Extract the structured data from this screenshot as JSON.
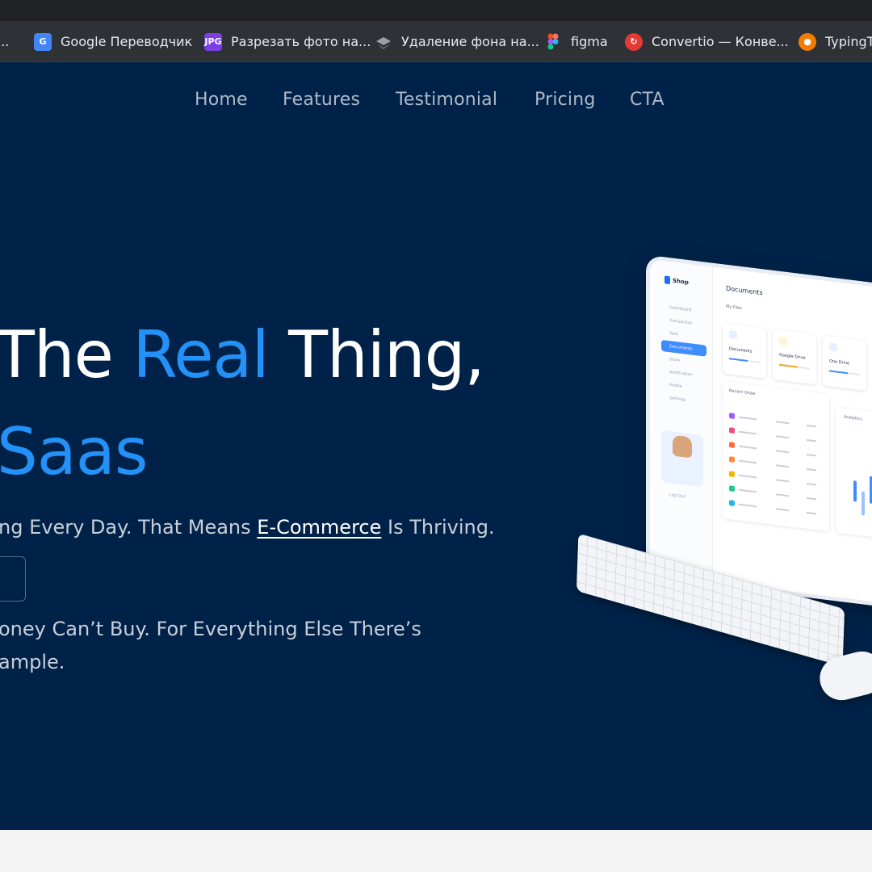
{
  "bookmarks": [
    {
      "label": "...",
      "icon": "bookmark-icon"
    },
    {
      "label": "Google Переводчик",
      "icon": "google-translate-icon",
      "color": "#4285f4"
    },
    {
      "label": "Разрезать фото на...",
      "icon": "jpg-icon",
      "color": "#7b3fe4"
    },
    {
      "label": "Удаление фона на...",
      "icon": "layers-icon",
      "color": "#9aa0a6"
    },
    {
      "label": "figma",
      "icon": "figma-icon",
      "color": "#f24e1e"
    },
    {
      "label": "Convertio — Конве...",
      "icon": "convertio-icon",
      "color": "#e53935"
    },
    {
      "label": "TypingT",
      "icon": "typing-icon",
      "color": "#f57c00"
    }
  ],
  "nav": [
    "Home",
    "Features",
    "Testimonial",
    "Pricing",
    "CTA"
  ],
  "hero": {
    "title_line1_a": "The ",
    "title_line1_accent": "Real",
    "title_line1_b": " Thing,",
    "title_line2_accent": "Saas",
    "subtitle_a": "ng Every Day. That Means ",
    "subtitle_link": "E-Commerce",
    "subtitle_b": " Is Thriving.",
    "body_line1": "oney Can’t Buy. For Everything Else There’s",
    "body_line2": "ample."
  },
  "colors": {
    "hero_bg": "#002248",
    "accent": "#2391f7",
    "browser_bar": "#2e3136"
  },
  "monitor": {
    "logo": "Shop",
    "title": "Documents",
    "section": "My Files",
    "menu": [
      "Dashboard",
      "Transaction",
      "Task",
      "Documents",
      "Store",
      "Notification",
      "Profile",
      "Settings"
    ],
    "cards": [
      "Documents",
      "Google Drive",
      "One Drive"
    ],
    "recent": "Recent Order",
    "analytics": "Analytics",
    "logout": "Log Out"
  }
}
